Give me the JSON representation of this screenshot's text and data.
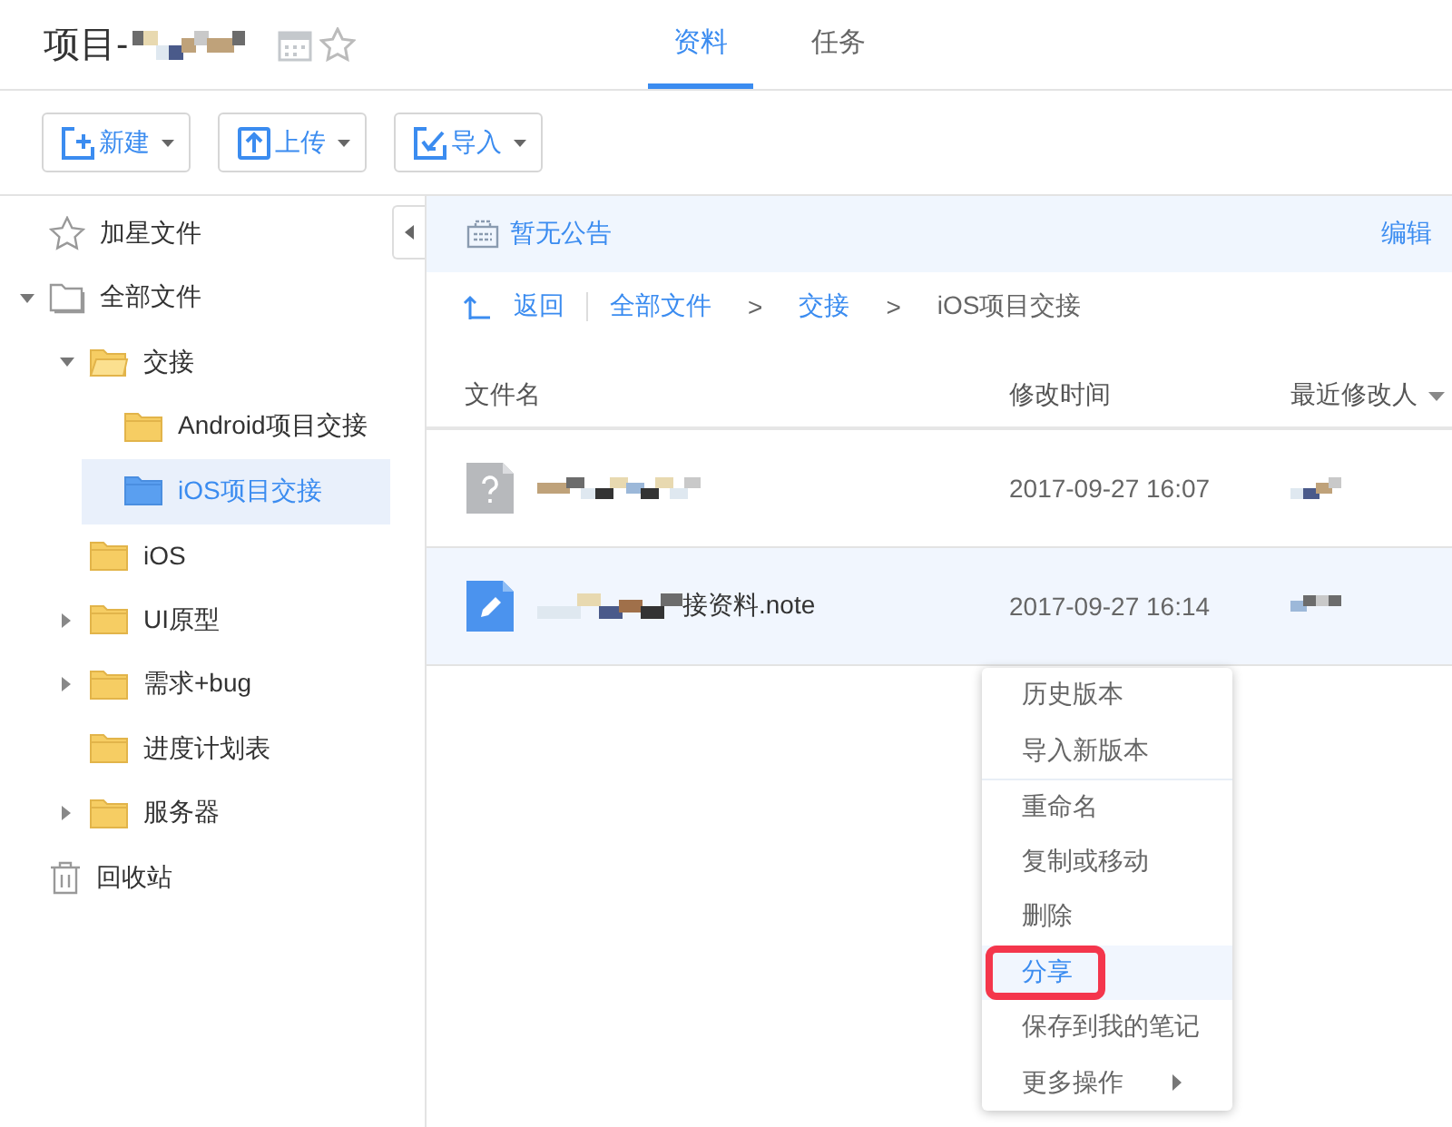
{
  "header": {
    "title": "项目-",
    "tabs": [
      {
        "label": "资料",
        "selected": true
      },
      {
        "label": "任务",
        "selected": false
      }
    ]
  },
  "toolbar": {
    "buttons": [
      {
        "label": "新建",
        "kind": "new"
      },
      {
        "label": "上传",
        "kind": "upload"
      },
      {
        "label": "导入",
        "kind": "import"
      }
    ]
  },
  "sidebar": {
    "items": [
      {
        "label": "加星文件",
        "kind": "star",
        "selected": false,
        "expandable": false
      },
      {
        "label": "全部文件",
        "kind": "all",
        "selected": false,
        "expandable": true,
        "expanded": true,
        "children": [
          {
            "label": "交接",
            "kind": "folder",
            "selected": false,
            "expandable": true,
            "expanded": true,
            "children": [
              {
                "label": "Android项目交接",
                "kind": "folder",
                "selected": false,
                "expandable": false
              },
              {
                "label": "iOS项目交接",
                "kind": "folder",
                "selected": true,
                "expandable": false
              }
            ]
          },
          {
            "label": "iOS",
            "kind": "folder",
            "selected": false,
            "expandable": false
          },
          {
            "label": "UI原型",
            "kind": "folder",
            "selected": false,
            "expandable": true,
            "expanded": false
          },
          {
            "label": "需求+bug",
            "kind": "folder",
            "selected": false,
            "expandable": true,
            "expanded": false
          },
          {
            "label": "进度计划表",
            "kind": "folder",
            "selected": false,
            "expandable": false
          },
          {
            "label": "服务器",
            "kind": "folder",
            "selected": false,
            "expandable": true,
            "expanded": false
          }
        ]
      },
      {
        "label": "回收站",
        "kind": "trash",
        "selected": false,
        "expandable": false
      }
    ]
  },
  "notice": {
    "text": "暂无公告",
    "action": "编辑"
  },
  "breadcrumb": {
    "back": "返回",
    "links": [
      "全部文件",
      "交接"
    ],
    "separators": [
      ">",
      ">"
    ],
    "current": "iOS项目交接"
  },
  "table": {
    "columns": [
      "文件名",
      "修改时间",
      "最近修改人"
    ],
    "rows": [
      {
        "kind": "unknown",
        "name": "",
        "time": "2017-09-27 16:07",
        "selected": false
      },
      {
        "kind": "note",
        "name": "接资料.note",
        "time": "2017-09-27 16:14",
        "selected": true
      }
    ]
  },
  "context_menu": {
    "items": [
      {
        "label": "历史版本",
        "selected": false,
        "outlined": false,
        "separator_before": false,
        "submenu": false
      },
      {
        "label": "导入新版本",
        "selected": false,
        "outlined": false,
        "separator_before": false,
        "submenu": false
      },
      {
        "label": "重命名",
        "selected": false,
        "outlined": false,
        "separator_before": true,
        "submenu": false
      },
      {
        "label": "复制或移动",
        "selected": false,
        "outlined": false,
        "separator_before": false,
        "submenu": false
      },
      {
        "label": "删除",
        "selected": false,
        "outlined": false,
        "separator_before": false,
        "submenu": false
      },
      {
        "label": "分享",
        "selected": true,
        "outlined": true,
        "separator_before": false,
        "submenu": false
      },
      {
        "label": "保存到我的笔记",
        "selected": false,
        "outlined": false,
        "separator_before": false,
        "submenu": false
      },
      {
        "label": "更多操作",
        "selected": false,
        "outlined": false,
        "separator_before": false,
        "submenu": true
      }
    ]
  }
}
